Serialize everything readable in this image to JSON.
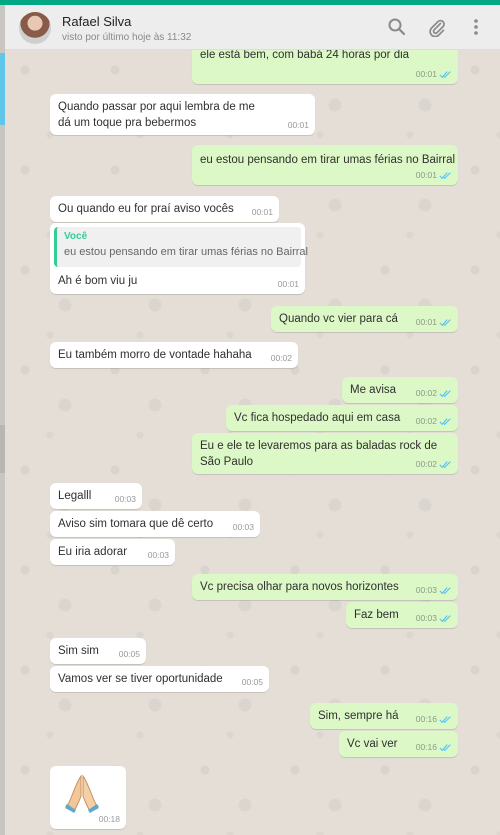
{
  "header": {
    "contact_name": "Rafael Silva",
    "status": "visto por último hoje às 11:32",
    "icons": [
      "search-icon",
      "paperclip-icon",
      "menu-dots-icon"
    ]
  },
  "colors": {
    "accent": "#00a884",
    "incoming_bubble": "#ffffff",
    "outgoing_bubble": "#dcf8c6",
    "read_check": "#4fc3f7",
    "quote_author": "#35cd96"
  },
  "messages": [
    {
      "dir": "out",
      "text": "ele está bem, com babá 24 horas por dia",
      "time": "00:01",
      "read": true
    },
    {
      "dir": "in",
      "text": "Quando passar por aqui lembra de me dá um toque pra bebermos",
      "time": "00:01"
    },
    {
      "dir": "out",
      "text": "eu estou pensando em tirar umas férias no Bairral",
      "time": "00:01",
      "read": true
    },
    {
      "dir": "in",
      "text": "Ou quando eu for praí aviso vocês",
      "time": "00:01"
    },
    {
      "dir": "in",
      "quote_author": "Você",
      "quote_text": "eu estou pensando em tirar umas férias no Bairral",
      "text": "Ah é bom viu ju",
      "time": "00:01"
    },
    {
      "dir": "out",
      "text": "Quando vc vier para cá",
      "time": "00:01",
      "read": true
    },
    {
      "dir": "in",
      "text": "Eu também morro de vontade hahaha",
      "time": "00:02"
    },
    {
      "dir": "out",
      "text": "Me avisa",
      "time": "00:02",
      "read": true
    },
    {
      "dir": "out",
      "text": "Vc fica hospedado aqui em casa",
      "time": "00:02",
      "read": true
    },
    {
      "dir": "out",
      "text": "Eu e ele te levaremos para as baladas rock de São Paulo",
      "time": "00:02",
      "read": true
    },
    {
      "dir": "in",
      "text": "Legalll",
      "time": "00:03"
    },
    {
      "dir": "in",
      "text": "Aviso sim tomara que dê certo",
      "time": "00:03"
    },
    {
      "dir": "in",
      "text": "Eu iria adorar",
      "time": "00:03"
    },
    {
      "dir": "out",
      "text": "Vc precisa olhar para novos horizontes",
      "time": "00:03",
      "read": true
    },
    {
      "dir": "out",
      "text": "Faz bem",
      "time": "00:03",
      "read": true
    },
    {
      "dir": "in",
      "text": "Sim sim",
      "time": "00:05"
    },
    {
      "dir": "in",
      "text": "Vamos ver se tiver oportunidade",
      "time": "00:05"
    },
    {
      "dir": "out",
      "text": "Sim, sempre há",
      "time": "00:16",
      "read": true
    },
    {
      "dir": "out",
      "text": "Vc vai ver",
      "time": "00:16",
      "read": true
    },
    {
      "dir": "in",
      "emoji": "folded-hands",
      "time": "00:18"
    }
  ]
}
